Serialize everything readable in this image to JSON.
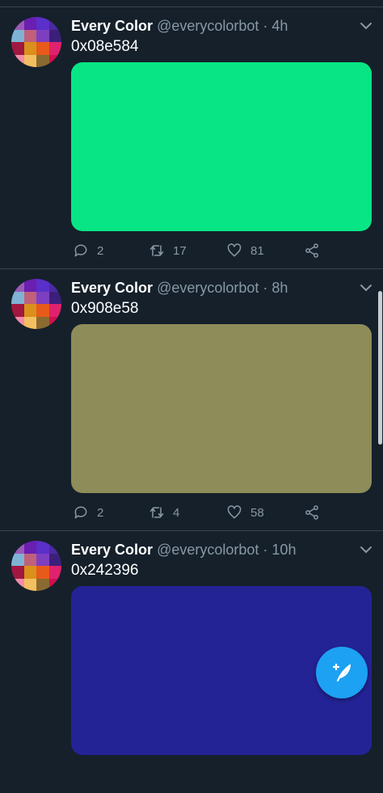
{
  "avatar_colors": [
    "#9b59b6",
    "#6a1fb0",
    "#5b2fc9",
    "#4a2aa0",
    "#7fb3d5",
    "#c0607a",
    "#7d3fc0",
    "#3c1f7a",
    "#a01840",
    "#d9901c",
    "#e85a1a",
    "#e0216e",
    "#f28aa8",
    "#f2c060",
    "#8a6a30",
    "#d01050"
  ],
  "tweets": [
    {
      "name": "Every Color",
      "handle": "@everycolorbot",
      "separator": "·",
      "time": "4h",
      "text": "0x08e584",
      "color": "#08e584",
      "replies": "2",
      "retweets": "17",
      "likes": "81"
    },
    {
      "name": "Every Color",
      "handle": "@everycolorbot",
      "separator": "·",
      "time": "8h",
      "text": "0x908e58",
      "color": "#8e8c58",
      "replies": "2",
      "retweets": "4",
      "likes": "58"
    },
    {
      "name": "Every Color",
      "handle": "@everycolorbot",
      "separator": "·",
      "time": "10h",
      "text": "0x242396",
      "color": "#242396"
    }
  ]
}
